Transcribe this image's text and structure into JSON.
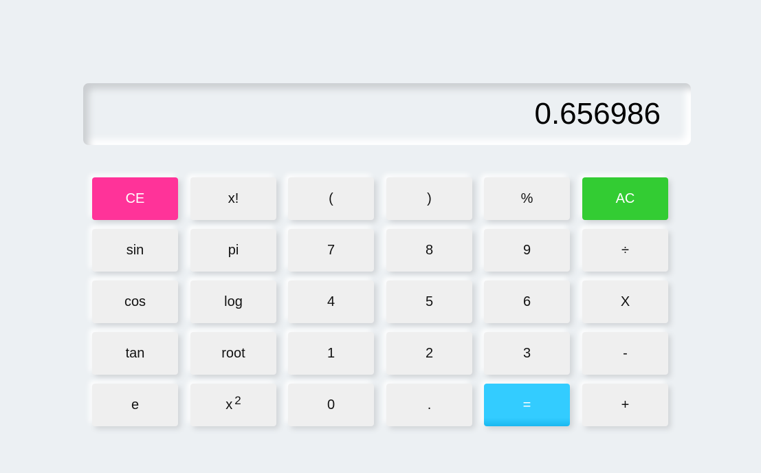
{
  "display": {
    "value": "0.656986"
  },
  "buttons": {
    "ce": "CE",
    "factorial": "x!",
    "open_paren": "(",
    "close_paren": ")",
    "percent": "%",
    "ac": "AC",
    "sin": "sin",
    "pi": "pi",
    "seven": "7",
    "eight": "8",
    "nine": "9",
    "divide": "÷",
    "cos": "cos",
    "log": "log",
    "four": "4",
    "five": "5",
    "six": "6",
    "multiply": "X",
    "tan": "tan",
    "root": "root",
    "one": "1",
    "two": "2",
    "three": "3",
    "minus": "-",
    "e": "e",
    "square_base": "x",
    "square_exp": "2",
    "zero": "0",
    "dot": ".",
    "equals": "=",
    "plus": "+"
  },
  "colors": {
    "background": "#ecf0f3",
    "button": "#efefef",
    "ce": "#ff3399",
    "ac": "#33cc33",
    "equals": "#33ccff"
  }
}
